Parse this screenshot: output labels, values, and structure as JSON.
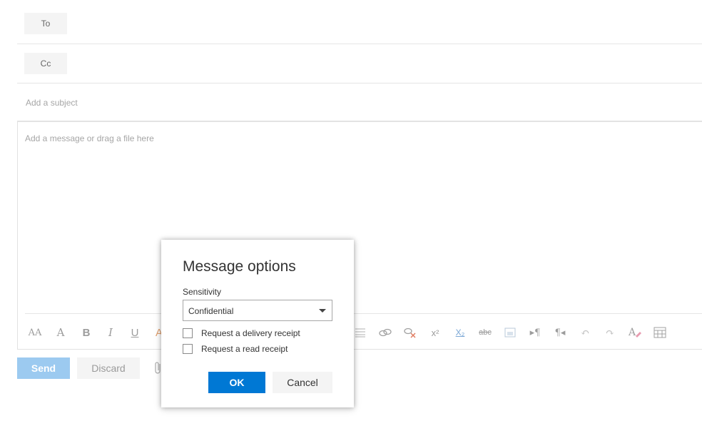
{
  "compose": {
    "to_label": "To",
    "cc_label": "Cc",
    "subject_placeholder": "Add a subject",
    "body_placeholder": "Add a message or drag a file here",
    "send_label": "Send",
    "discard_label": "Discard"
  },
  "toolbar": {
    "icons": [
      "font-size-icon",
      "grow-font-icon",
      "bold-icon",
      "italic-icon",
      "underline-icon",
      "font-color-icon",
      "align-icon",
      "link-icon",
      "unlink-icon",
      "superscript-icon",
      "subscript-icon",
      "strikethrough-icon",
      "image-icon",
      "ltr-icon",
      "rtl-icon",
      "undo-icon",
      "redo-icon",
      "clear-format-icon",
      "table-icon"
    ],
    "glyphs": {
      "font_size": "AA",
      "grow_font": "A",
      "bold": "B",
      "italic": "I",
      "underline": "U",
      "superscript": "x²",
      "subscript": "X₂",
      "strike": "abc",
      "ltr": "▸¶",
      "rtl": "¶◂",
      "undo": "↶",
      "redo": "↷"
    }
  },
  "dialog": {
    "title": "Message options",
    "sensitivity_label": "Sensitivity",
    "sensitivity_value": "Confidential",
    "delivery_receipt_label": "Request a delivery receipt",
    "delivery_receipt_checked": false,
    "read_receipt_label": "Request a read receipt",
    "read_receipt_checked": false,
    "ok_label": "OK",
    "cancel_label": "Cancel"
  },
  "colors": {
    "accent": "#0078d4",
    "send_disabled": "#9ccaf0"
  }
}
